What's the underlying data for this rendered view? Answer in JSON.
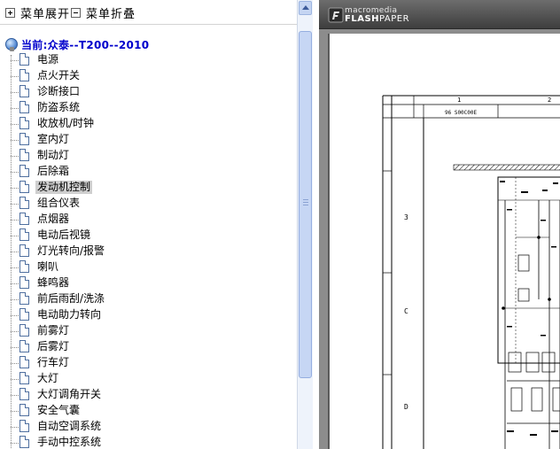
{
  "toolbar": {
    "expand_label": "菜单展开",
    "collapse_label": "菜单折叠"
  },
  "tree": {
    "root_label": "当前:众泰--T200--2010",
    "items": [
      {
        "label": "电源"
      },
      {
        "label": "点火开关"
      },
      {
        "label": "诊断接口"
      },
      {
        "label": "防盗系统"
      },
      {
        "label": "收放机/时钟"
      },
      {
        "label": "室内灯"
      },
      {
        "label": "制动灯"
      },
      {
        "label": "后除霜"
      },
      {
        "label": "发动机控制",
        "selected": true
      },
      {
        "label": "组合仪表"
      },
      {
        "label": "点烟器"
      },
      {
        "label": "电动后视镜"
      },
      {
        "label": "灯光转向/报警"
      },
      {
        "label": "喇叭"
      },
      {
        "label": "蜂鸣器"
      },
      {
        "label": "前后雨刮/洗涤"
      },
      {
        "label": "电动助力转向"
      },
      {
        "label": "前雾灯"
      },
      {
        "label": "后雾灯"
      },
      {
        "label": "行车灯"
      },
      {
        "label": "大灯"
      },
      {
        "label": "大灯调角开关"
      },
      {
        "label": "安全气囊"
      },
      {
        "label": "自动空调系统"
      },
      {
        "label": "手动中控系统"
      }
    ]
  },
  "viewer": {
    "brand_small": "macromedia",
    "brand_flash": "FLASH",
    "brand_paper": "PAPER",
    "page": {
      "row_labels": [
        "3",
        "C",
        "D"
      ],
      "col_labels": [
        "1",
        "2"
      ],
      "header_text": "96 S00C00E"
    }
  },
  "colors": {
    "root_text": "#0000cc",
    "selection": "#cfcfcf",
    "viewer_bar": "#4a4a4a"
  },
  "icons": {
    "expand": "plus-box-icon",
    "collapse": "minus-box-icon",
    "root": "globe-icon",
    "node": "document-icon"
  }
}
